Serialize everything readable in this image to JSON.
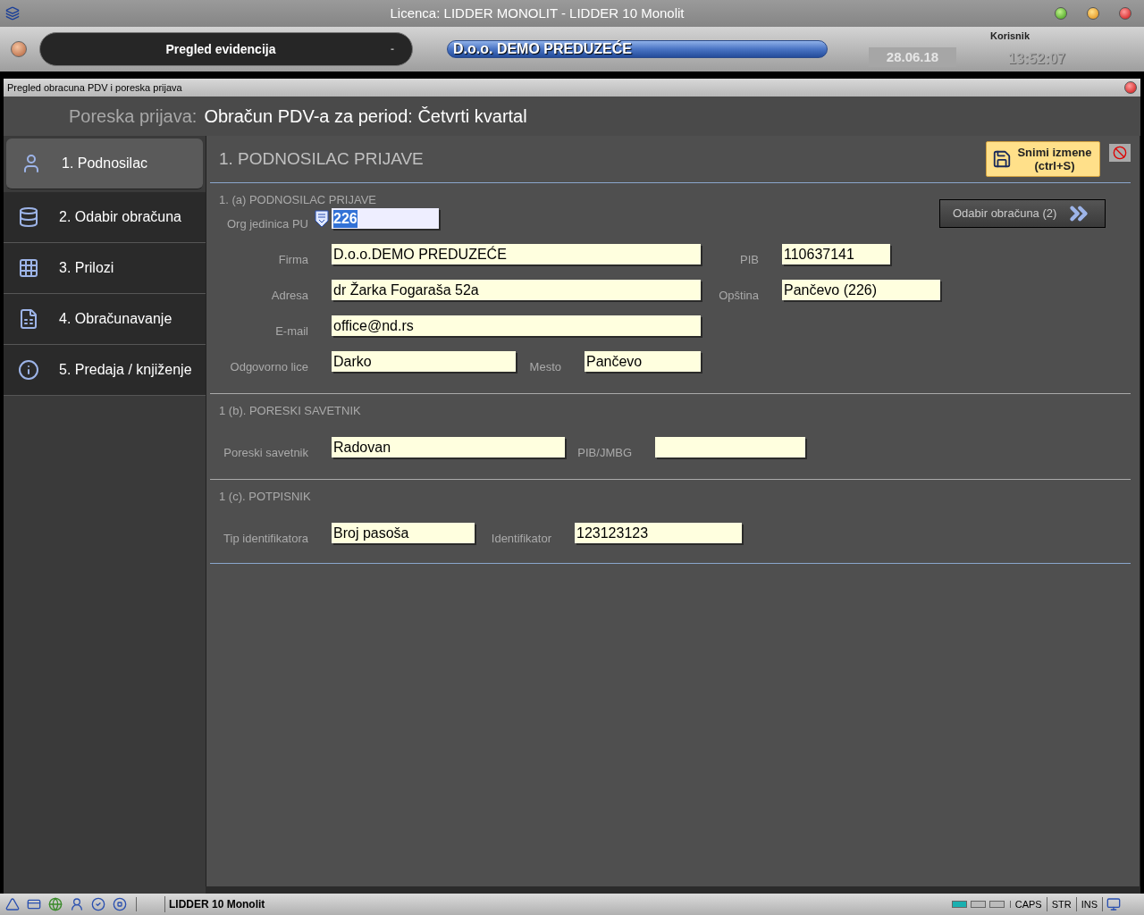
{
  "window": {
    "title": "Licenca: LIDDER MONOLIT - LIDDER 10 Monolit"
  },
  "toolbar": {
    "module": "Pregled evidencija",
    "module_caret": "-",
    "company": "D.o.o. DEMO PREDUZEĆE",
    "date": "28.06.18",
    "user_label": "Korisnik",
    "time": "13:52:07"
  },
  "subwindow": {
    "title": "Pregled obracuna PDV i poreska prijava"
  },
  "header": {
    "label": "Poreska prijava:",
    "value": "Obračun PDV-a za period: Četvrti kvartal"
  },
  "sidebar": {
    "items": [
      {
        "label": "1. Podnosilac",
        "kind": "person",
        "selected": true
      },
      {
        "label": "2. Odabir obračuna",
        "kind": "database",
        "selected": false
      },
      {
        "label": "3. Prilozi",
        "kind": "grid",
        "selected": false
      },
      {
        "label": "4. Obračunavanje",
        "kind": "sheet",
        "selected": false
      },
      {
        "label": "5. Predaja / knjiženje",
        "kind": "info",
        "selected": false
      }
    ]
  },
  "panel": {
    "title": "1. PODNOSILAC PRIJAVE",
    "save_button": {
      "line1": "Snimi izmene",
      "line2": "(ctrl+S)"
    },
    "next_button": "Odabir obračuna (2)",
    "sections": [
      {
        "title": "1. (a) PODNOSILAC PRIJAVE",
        "rows": [
          [
            {
              "label": "Org jedinica PU",
              "value": "226",
              "focused": true
            }
          ],
          [
            {
              "label": "Firma",
              "value": "D.o.o.DEMO PREDUZEĆE",
              "focused": false
            },
            {
              "label": "PIB",
              "value": "110637141",
              "focused": false
            }
          ],
          [
            {
              "label": "Adresa",
              "value": "dr Žarka Fogaraša 52a",
              "focused": false
            },
            {
              "label": "Opština",
              "value": "Pančevo (226)",
              "focused": false
            }
          ],
          [
            {
              "label": "E-mail",
              "value": "office@nd.rs",
              "focused": false
            }
          ],
          [
            {
              "label": "Odgovorno lice",
              "value": "Darko",
              "focused": false
            },
            {
              "label": "Mesto",
              "value": "Pančevo",
              "focused": false
            }
          ]
        ]
      },
      {
        "title": "1 (b). PORESKI SAVETNIK",
        "rows": [
          [
            {
              "label": "Poreski savetnik",
              "value": "Radovan",
              "focused": false
            },
            {
              "label": "PIB/JMBG",
              "focused": false
            }
          ]
        ]
      },
      {
        "title": "1 (c). POTPISNIK",
        "rows": [
          [
            {
              "label": "Tip identifikatora",
              "value": "Broj pasoša",
              "focused": false
            },
            {
              "label": "Identifikator",
              "value": "123123123",
              "focused": false
            }
          ]
        ]
      }
    ]
  },
  "status_bar": {
    "app": "LIDDER 10 Monolit",
    "indicators": [
      {
        "on": true
      },
      {
        "on": false
      },
      {
        "on": false
      }
    ],
    "keys": [
      "CAPS",
      "STR",
      "INS"
    ]
  }
}
